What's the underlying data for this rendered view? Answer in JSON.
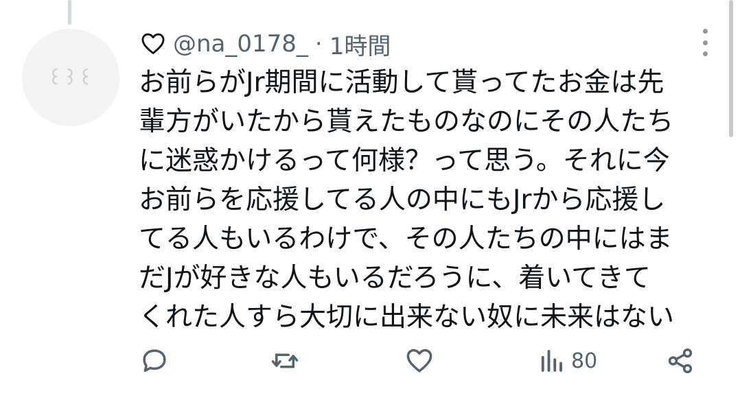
{
  "tweet": {
    "username": "@na_0178_",
    "separator": "·",
    "time": "1時間",
    "lines": [
      "お前らがJr期間に活動して貰ってたお金は先",
      "輩方がいたから貰えたものなのにその人たち",
      "に迷惑かけるって何様？って思う。それに今",
      "お前らを応援してる人の中にもJrから応援し",
      "てる人もいるわけで、その人たちの中にはま",
      "だJが好きな人もいるだろうに、着いてきて",
      "くれた人すら大切に出来ない奴に未来はない"
    ]
  },
  "actions": {
    "views_count": "80"
  },
  "icons": {
    "header": "heart-icon",
    "more": "more-vertical-icon",
    "reply": "reply-icon",
    "retweet": "retweet-icon",
    "like": "like-icon",
    "views": "views-icon",
    "share": "share-icon"
  },
  "colors": {
    "text": "#0f1419",
    "secondary": "#536471",
    "background": "#ffffff"
  }
}
